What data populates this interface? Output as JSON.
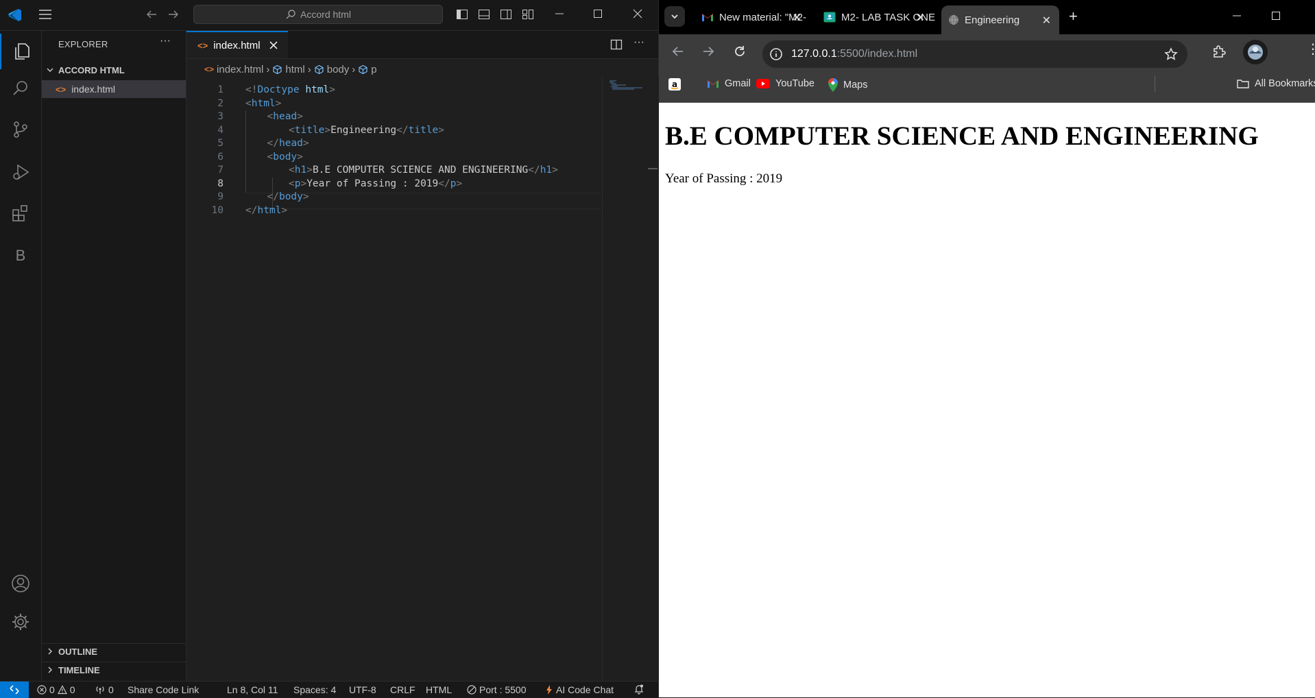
{
  "vscode": {
    "title_search": "Accord html",
    "sidebar": {
      "title": "EXPLORER",
      "folder": "ACCORD HTML",
      "file": "index.html",
      "outline": "OUTLINE",
      "timeline": "TIMELINE"
    },
    "activity_bar": {
      "icons": [
        "explorer-icon",
        "search-icon",
        "source-control-icon",
        "run-debug-icon",
        "extensions-icon",
        "b-extension-icon",
        "account-icon",
        "settings-gear-icon"
      ],
      "b_label": "B"
    },
    "tab": {
      "label": "index.html"
    },
    "breadcrumb": [
      "index.html",
      "html",
      "body",
      "p"
    ],
    "editor": {
      "current_line": 8,
      "lines": [
        {
          "n": "1",
          "indent": 0,
          "parts": [
            [
              "tg",
              "<!"
            ],
            [
              "tn",
              "Doctype"
            ],
            [
              "tx",
              " "
            ],
            [
              "kw",
              "html"
            ],
            [
              "tg",
              ">"
            ]
          ]
        },
        {
          "n": "2",
          "indent": 0,
          "parts": [
            [
              "tg",
              "<"
            ],
            [
              "tn",
              "html"
            ],
            [
              "tg",
              ">"
            ]
          ]
        },
        {
          "n": "3",
          "indent": 1,
          "parts": [
            [
              "tg",
              "<"
            ],
            [
              "tn",
              "head"
            ],
            [
              "tg",
              ">"
            ]
          ]
        },
        {
          "n": "4",
          "indent": 2,
          "parts": [
            [
              "tg",
              "<"
            ],
            [
              "tn",
              "title"
            ],
            [
              "tg",
              ">"
            ],
            [
              "tx",
              "Engineering"
            ],
            [
              "tg",
              "</"
            ],
            [
              "tn",
              "title"
            ],
            [
              "tg",
              ">"
            ]
          ]
        },
        {
          "n": "5",
          "indent": 1,
          "parts": [
            [
              "tg",
              "</"
            ],
            [
              "tn",
              "head"
            ],
            [
              "tg",
              ">"
            ]
          ]
        },
        {
          "n": "6",
          "indent": 1,
          "parts": [
            [
              "tg",
              "<"
            ],
            [
              "tn",
              "body"
            ],
            [
              "tg",
              ">"
            ]
          ]
        },
        {
          "n": "7",
          "indent": 2,
          "parts": [
            [
              "tg",
              "<"
            ],
            [
              "tn",
              "h1"
            ],
            [
              "tg",
              ">"
            ],
            [
              "tx",
              "B.E COMPUTER SCIENCE AND ENGINEERING"
            ],
            [
              "tg",
              "</"
            ],
            [
              "tn",
              "h1"
            ],
            [
              "tg",
              ">"
            ]
          ]
        },
        {
          "n": "8",
          "indent": 2,
          "parts": [
            [
              "tg",
              "<"
            ],
            [
              "tn",
              "p"
            ],
            [
              "tg",
              ">"
            ],
            [
              "tx",
              "Year of Passing : 2019"
            ],
            [
              "tg",
              "</"
            ],
            [
              "tn",
              "p"
            ],
            [
              "tg",
              ">"
            ]
          ]
        },
        {
          "n": "9",
          "indent": 1,
          "parts": [
            [
              "tg",
              "</"
            ],
            [
              "tn",
              "body"
            ],
            [
              "tg",
              ">"
            ]
          ]
        },
        {
          "n": "10",
          "indent": 0,
          "parts": [
            [
              "tg",
              "</"
            ],
            [
              "tn",
              "html"
            ],
            [
              "tg",
              ">"
            ]
          ]
        }
      ]
    },
    "statusbar": {
      "errors": "0",
      "warnings": "0",
      "ports": "0",
      "share": "Share Code Link",
      "position": "Ln 8, Col 11",
      "spaces": "Spaces: 4",
      "encoding": "UTF-8",
      "eol": "CRLF",
      "language": "HTML",
      "port": "Port : 5500",
      "ai": "AI Code Chat"
    },
    "colors": {
      "accent": "#0078d4",
      "tag": "#569cd6",
      "bracket": "#808080",
      "attr": "#9cdcfe"
    }
  },
  "chrome": {
    "tabs": [
      {
        "label": "New material: \"M2-",
        "icon": "gmail-icon"
      },
      {
        "label": "M2- LAB TASK ONE",
        "icon": "classroom-icon"
      },
      {
        "label": "Engineering",
        "icon": "globe-icon",
        "active": true
      }
    ],
    "url_host": "127.0.0.1",
    "url_rest": ":5500/index.html",
    "bookmarks": [
      {
        "label": "",
        "icon": "amazon-icon"
      },
      {
        "label": "Gmail",
        "icon": "gmail-icon"
      },
      {
        "label": "YouTube",
        "icon": "youtube-icon"
      },
      {
        "label": "Maps",
        "icon": "maps-icon"
      }
    ],
    "all_bookmarks": "All Bookmarks",
    "page": {
      "h1": "B.E COMPUTER SCIENCE AND ENGINEERING",
      "p": "Year of Passing : 2019"
    }
  }
}
